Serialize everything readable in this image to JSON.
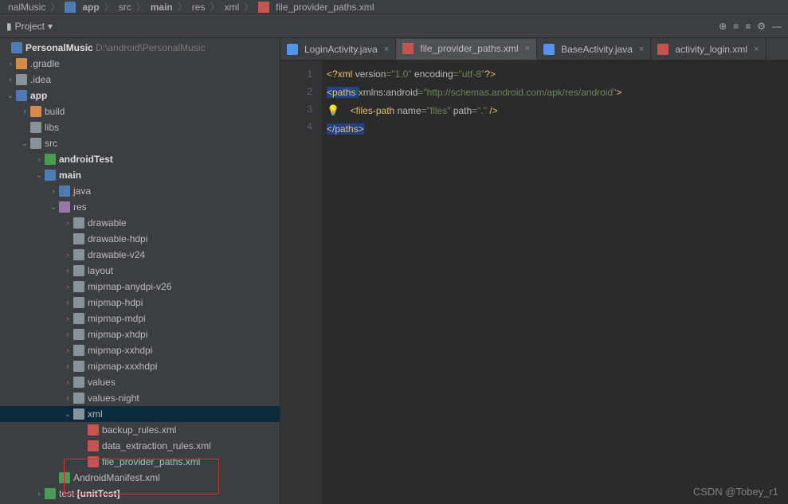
{
  "breadcrumb": [
    "nalMusic",
    "app",
    "src",
    "main",
    "res",
    "xml",
    "file_provider_paths.xml"
  ],
  "project": {
    "label": "Project"
  },
  "root": {
    "name": "PersonalMusic",
    "path": "D:\\android\\PersonalMusic"
  },
  "tree": {
    "gradle": ".gradle",
    "idea": ".idea",
    "app": "app",
    "build": "build",
    "libs": "libs",
    "src": "src",
    "androidTest": "androidTest",
    "main": "main",
    "java": "java",
    "res": "res",
    "drawable": "drawable",
    "drawable_hdpi": "drawable-hdpi",
    "drawable_v24": "drawable-v24",
    "layout": "layout",
    "mipmap_anydpi_v26": "mipmap-anydpi-v26",
    "mipmap_hdpi": "mipmap-hdpi",
    "mipmap_mdpi": "mipmap-mdpi",
    "mipmap_xhdpi": "mipmap-xhdpi",
    "mipmap_xxhdpi": "mipmap-xxhdpi",
    "mipmap_xxxhdpi": "mipmap-xxxhdpi",
    "values": "values",
    "values_night": "values-night",
    "xml": "xml",
    "backup_rules": "backup_rules.xml",
    "data_extraction": "data_extraction_rules.xml",
    "file_provider": "file_provider_paths.xml",
    "manifest": "AndroidManifest.xml",
    "test": "test",
    "unitTest": "[unitTest]"
  },
  "tabs": [
    {
      "label": "LoginActivity.java",
      "icon": "java"
    },
    {
      "label": "file_provider_paths.xml",
      "icon": "xml",
      "active": true
    },
    {
      "label": "BaseActivity.java",
      "icon": "java"
    },
    {
      "label": "activity_login.xml",
      "icon": "xml"
    }
  ],
  "gutter": [
    "1",
    "2",
    "3",
    "4"
  ],
  "code": {
    "l1_a": "<?",
    "l1_b": "xml ",
    "l1_c": "version",
    "l1_d": "=\"1.0\" ",
    "l1_e": "encoding",
    "l1_f": "=\"utf-8\"",
    "l1_g": "?>",
    "l2_a": "<paths ",
    "l2_b": "xmlns:android",
    "l2_c": "=\"http://schemas.android.com/apk/res/android\"",
    "l2_d": ">",
    "l3_a": "    ",
    "l3_b": "<files-path ",
    "l3_c": "name",
    "l3_d": "=\"files\" ",
    "l3_e": "path",
    "l3_f": "=\".\" ",
    "l3_g": "/>",
    "l4_a": "</paths>"
  },
  "watermark": "CSDN @Tobey_r1"
}
